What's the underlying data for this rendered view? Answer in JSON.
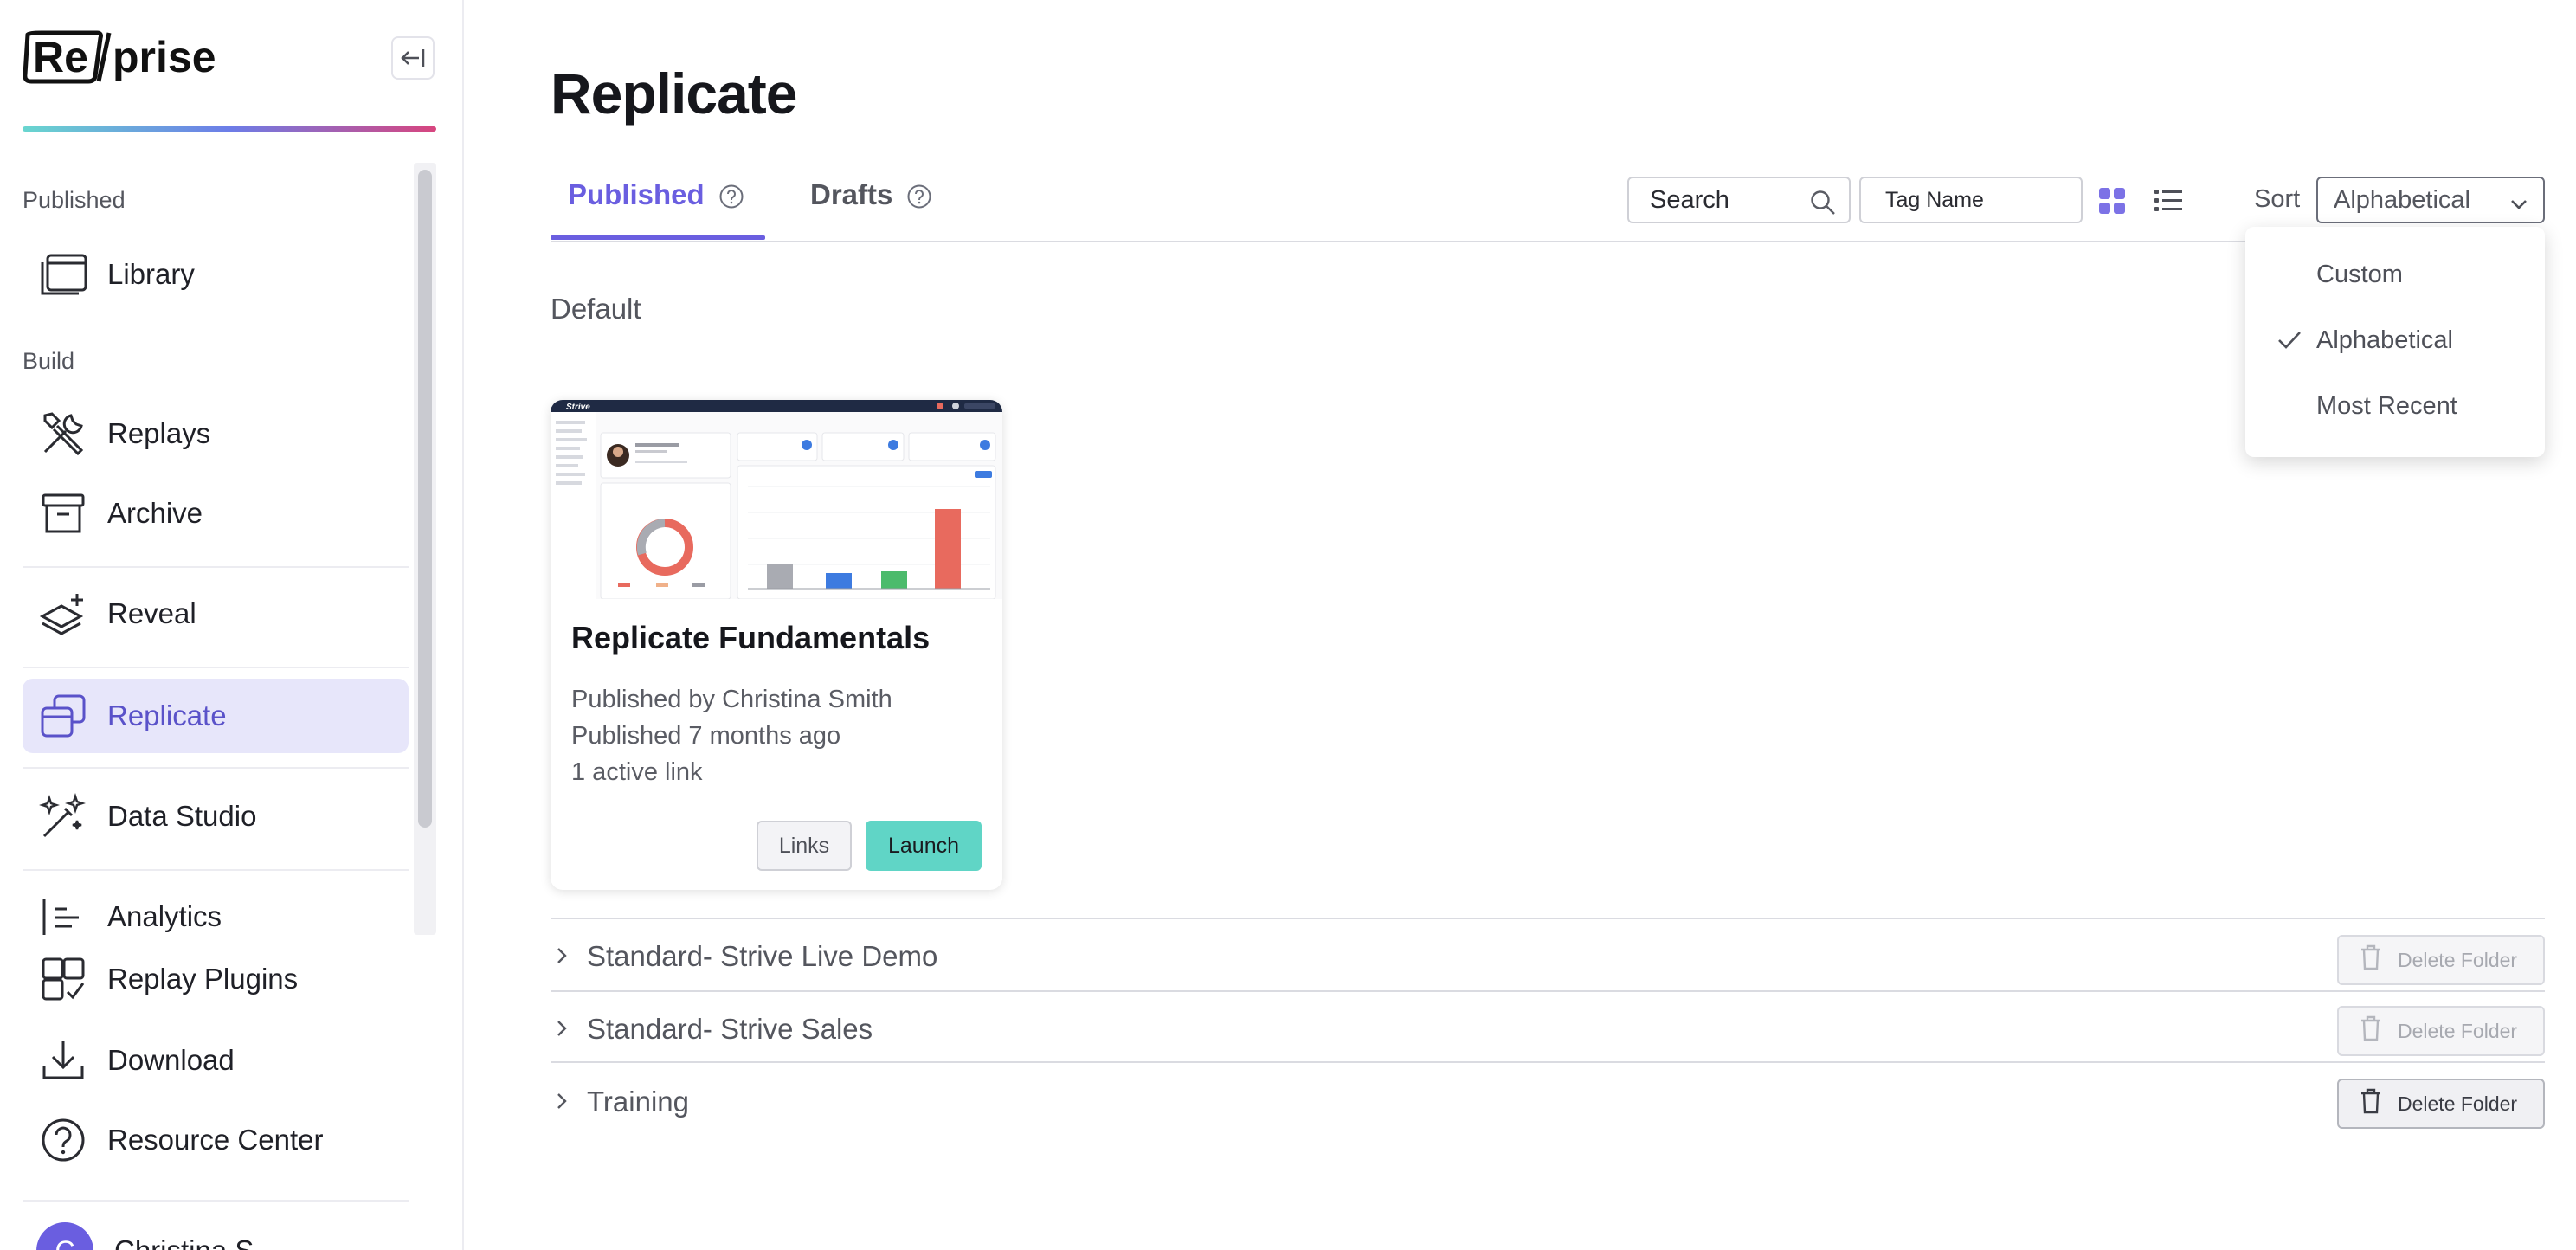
{
  "app": {
    "logo_text": "Reprise"
  },
  "sidebar": {
    "sections": {
      "published": "Published",
      "build": "Build"
    },
    "items": [
      {
        "label": "Library",
        "icon": "library-icon"
      },
      {
        "label": "Replays",
        "icon": "tools-icon"
      },
      {
        "label": "Archive",
        "icon": "archive-box-icon"
      },
      {
        "label": "Reveal",
        "icon": "layers-plus-icon"
      },
      {
        "label": "Replicate",
        "icon": "replicate-icon",
        "active": true
      },
      {
        "label": "Data Studio",
        "icon": "magic-wand-icon"
      },
      {
        "label": "Analytics",
        "icon": "analytics-bars-icon"
      },
      {
        "label": "Replay Plugins",
        "icon": "puzzle-icon"
      },
      {
        "label": "Download",
        "icon": "download-icon"
      },
      {
        "label": "Resource Center",
        "icon": "question-circle-icon"
      }
    ],
    "user": {
      "initial": "C",
      "name": "Christina S."
    }
  },
  "main": {
    "title": "Replicate",
    "tabs": [
      {
        "label": "Published",
        "active": true
      },
      {
        "label": "Drafts",
        "active": false
      }
    ],
    "toolbar": {
      "search_placeholder": "Search",
      "tag_placeholder": "Tag Name",
      "sort_label": "Sort",
      "sort_value": "Alphabetical"
    },
    "sort_dropdown": {
      "options": [
        {
          "label": "Custom",
          "selected": false
        },
        {
          "label": "Alphabetical",
          "selected": true
        },
        {
          "label": "Most Recent",
          "selected": false
        }
      ]
    },
    "default_section": "Default",
    "card": {
      "title": "Replicate Fundamentals",
      "published_by": "Published by Christina Smith",
      "published_when": "Published 7 months ago",
      "links_count": "1 active link",
      "links_label": "Links",
      "launch_label": "Launch",
      "thumbnail": {
        "brand": "Strive"
      }
    },
    "folders": [
      {
        "name": "Standard- Strive Live Demo",
        "delete_label": "Delete Folder",
        "delete_enabled": false
      },
      {
        "name": "Standard- Strive Sales",
        "delete_label": "Delete Folder",
        "delete_enabled": false
      },
      {
        "name": "Training",
        "delete_label": "Delete Folder",
        "delete_enabled": true
      }
    ]
  },
  "colors": {
    "accent": "#6a5ee0",
    "active_bg": "#e7e6fa",
    "launch": "#60d5c6",
    "gradient_start": "#69d6cf",
    "gradient_mid": "#6c7de8",
    "gradient_end": "#d8457e"
  }
}
